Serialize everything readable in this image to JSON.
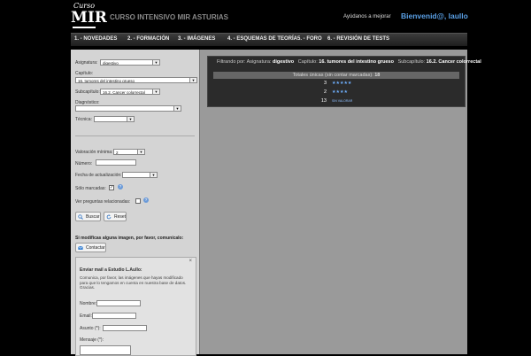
{
  "header": {
    "logo_small": "Curso",
    "logo_big": "MIR",
    "site_title": "CURSO INTENSIVO MIR ASTURIAS",
    "help_link": "Ayúdanos a mejorar",
    "welcome": "Bienvenid@, laullo"
  },
  "nav": {
    "items": [
      "1. - NOVEDADES",
      "2. - FORMACIÓN",
      "3. - IMÁGENES",
      "4. - ESQUEMAS DE TEORÍA",
      "5. - FORO",
      "6. - REVISIÓN DE TESTS"
    ]
  },
  "filters": {
    "asignatura_label": "Asignatura:",
    "asignatura_value": "digestivo",
    "capitulo_label": "Capítulo:",
    "capitulo_value": "16. tumores del intestino grueso",
    "subcapitulo_label": "Subcapítulo:",
    "subcapitulo_value": "16.2. Cancer colorrectal",
    "diagnostico_label": "Diagnóstico:",
    "diagnostico_value": "",
    "tecnica_label": "Técnica:",
    "tecnica_value": "",
    "valoracion_label": "Valoración mínima:",
    "valoracion_value": "2",
    "numero_label": "Número:",
    "fecha_label": "Fecha de actualización:",
    "fecha_value": "",
    "solo_marcadas_label": "Sólo marcadas:",
    "ver_preguntas_label": "Ver preguntas relacionadas:",
    "buscar_label": "Buscar",
    "reset_label": "Reset"
  },
  "contact": {
    "notice": "Si modificas alguna imagen, por favor, comunícalo:",
    "contactar_label": "Contactar",
    "close": "×",
    "mail_title": "Enviar mail a Estudio L.Aullo:",
    "mail_text": "Comunica, por favor, las imágenes que hayas modificado para que lo tengamos en cuenta en nuestra base de datos. Gracias.",
    "nombre_label": "Nombre:",
    "email_label": "Email:",
    "asunto_label": "Asunto (*):",
    "mensaje_label": "Mensaje (*):"
  },
  "results": {
    "filter_prefix": "Filtrando por:",
    "asignatura_label": "Asignatura:",
    "asignatura_value": "digestivo",
    "capitulo_label": "Capítulo:",
    "capitulo_value": "16. tumores del intestino grueso",
    "subcapitulo_label": "Subcapítulo:",
    "subcapitulo_value": "16.2. Cancer colorrectal",
    "totals_label": "Totales únicas (sin contar marcadas):",
    "totals_value": "18",
    "rows": [
      {
        "count": "3",
        "stars": "★★★★★",
        "rating": 5
      },
      {
        "count": "2",
        "stars": "★★★★",
        "rating": 4
      },
      {
        "count": "13",
        "sin_valorar": "SIN VALORAR"
      }
    ]
  }
}
